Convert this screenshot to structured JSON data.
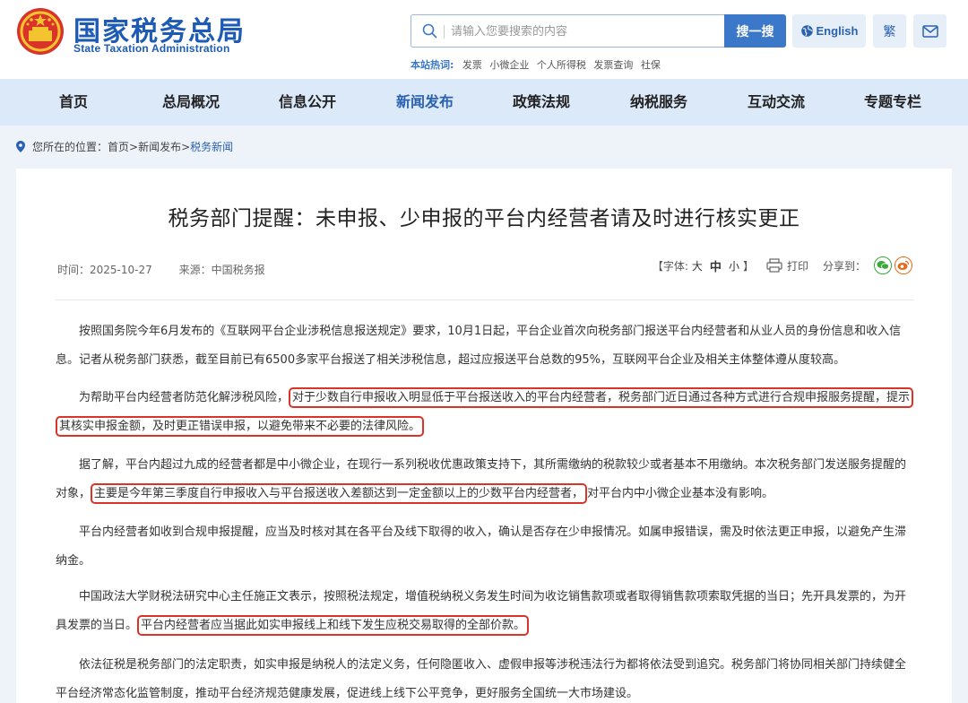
{
  "header": {
    "site_name_cn": "国家税务总局",
    "site_name_en": "State Taxation Administration",
    "search": {
      "placeholder": "请输入您要搜索的内容",
      "button_label": "搜一搜"
    },
    "english_label": "English",
    "traditional_label": "繁",
    "hotwords_label": "本站热词:",
    "hotwords": [
      "发票",
      "小微企业",
      "个人所得税",
      "发票查询",
      "社保"
    ]
  },
  "nav": {
    "items": [
      {
        "label": "首页"
      },
      {
        "label": "总局概况"
      },
      {
        "label": "信息公开"
      },
      {
        "label": "新闻发布",
        "active": true
      },
      {
        "label": "政策法规"
      },
      {
        "label": "纳税服务"
      },
      {
        "label": "互动交流"
      },
      {
        "label": "专题专栏"
      }
    ]
  },
  "breadcrumb": {
    "prefix": "您所在的位置：",
    "path": "首页>新闻发布>",
    "current": "税务新闻"
  },
  "article": {
    "title": "税务部门提醒：未申报、少申报的平台内经营者请及时进行核实更正",
    "date": "时间：2025-10-27",
    "source": "来源：中国税务报",
    "font_label": "【字体:",
    "font_large": "大",
    "font_medium": "中",
    "font_small": "小",
    "font_close": "】",
    "print_label": "打印",
    "share_label": "分享到：",
    "paragraphs": [
      {
        "text": "按照国务院今年6月发布的《互联网平台企业涉税信息报送规定》要求，10月1日起，平台企业首次向税务部门报送平台内经营者和从业人员的身份信息和收入信息。记者从税务部门获悉，截至目前已有6500多家平台报送了相关涉税信息，超过应报送平台总数的95%，互联网平台企业及相关主体整体遵从度较高。"
      },
      {
        "before": "为帮助平台内经营者防范化解涉税风险，",
        "highlight": "对于少数自行申报收入明显低于平台报送收入的平台内经营者，税务部门近日通过各种方式进行合规申报服务提醒，提示其核实申报金额，及时更正错误申报，以避免带来不必要的法律风险。",
        "after": ""
      },
      {
        "before": "据了解，平台内超过九成的经营者都是中小微企业，在现行一系列税收优惠政策支持下，其所需缴纳的税款较少或者基本不用缴纳。本次税务部门发送服务提醒的对象，",
        "highlight": "主要是今年第三季度自行申报收入与平台报送收入差额达到一定金额以上的少数平台内经营者，",
        "after": "对平台内中小微企业基本没有影响。"
      },
      {
        "text": "平台内经营者如收到合规申报提醒，应当及时核对其在各平台及线下取得的收入，确认是否存在少申报情况。如属申报错误，需及时依法更正申报，以避免产生滞纳金。"
      },
      {
        "before": "中国政法大学财税法研究中心主任施正文表示，按照税法规定，增值税纳税义务发生时间为收讫销售款项或者取得销售款项索取凭据的当日；先开具发票的，为开具发票的当日。",
        "highlight": "平台内经营者应当据此如实申报线上和线下发生应税交易取得的全部价款。",
        "after": ""
      },
      {
        "text": "依法征税是税务部门的法定职责，如实申报是纳税人的法定义务，任何隐匿收入、虚假申报等涉税违法行为都将依法受到追究。税务部门将协同相关部门持续健全平台经济常态化监管制度，推动平台经济规范健康发展，促进线上线下公平竞争，更好服务全国统一大市场建设。"
      }
    ]
  },
  "colors": {
    "brand_blue": "#1d5bb5",
    "nav_bg": "#dbe9f9",
    "highlight_border": "#d9332a",
    "page_bg": "#eef3f9"
  }
}
